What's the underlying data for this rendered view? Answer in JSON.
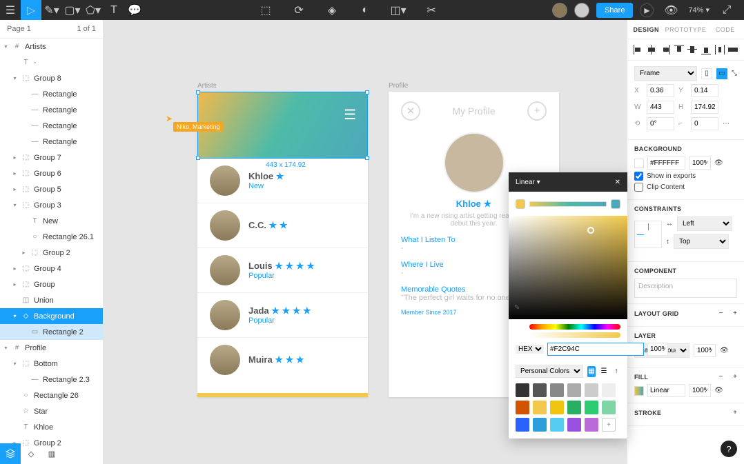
{
  "topbar": {
    "share": "Share",
    "zoom": "74%"
  },
  "pages": {
    "current": "Page 1",
    "count": "1 of 1"
  },
  "layers": [
    {
      "indent": 0,
      "exp": "▾",
      "icon": "#",
      "label": "Artists"
    },
    {
      "indent": 1,
      "exp": "",
      "icon": "T",
      "label": "·"
    },
    {
      "indent": 1,
      "exp": "▾",
      "icon": "⬚",
      "label": "Group 8"
    },
    {
      "indent": 2,
      "exp": "",
      "icon": "—",
      "label": "Rectangle"
    },
    {
      "indent": 2,
      "exp": "",
      "icon": "—",
      "label": "Rectangle"
    },
    {
      "indent": 2,
      "exp": "",
      "icon": "—",
      "label": "Rectangle"
    },
    {
      "indent": 2,
      "exp": "",
      "icon": "—",
      "label": "Rectangle"
    },
    {
      "indent": 1,
      "exp": "▸",
      "icon": "⬚",
      "label": "Group 7"
    },
    {
      "indent": 1,
      "exp": "▸",
      "icon": "⬚",
      "label": "Group 6"
    },
    {
      "indent": 1,
      "exp": "▸",
      "icon": "⬚",
      "label": "Group 5"
    },
    {
      "indent": 1,
      "exp": "▾",
      "icon": "⬚",
      "label": "Group 3"
    },
    {
      "indent": 2,
      "exp": "",
      "icon": "T",
      "label": "New"
    },
    {
      "indent": 2,
      "exp": "",
      "icon": "○",
      "label": "Rectangle 26.1"
    },
    {
      "indent": 2,
      "exp": "▸",
      "icon": "⬚",
      "label": "Group 2"
    },
    {
      "indent": 1,
      "exp": "▸",
      "icon": "⬚",
      "label": "Group 4"
    },
    {
      "indent": 1,
      "exp": "▸",
      "icon": "⬚",
      "label": "Group"
    },
    {
      "indent": 1,
      "exp": "",
      "icon": "◫",
      "label": "Union"
    },
    {
      "indent": 1,
      "exp": "▾",
      "icon": "◇",
      "label": "Background",
      "sel": true
    },
    {
      "indent": 2,
      "exp": "",
      "icon": "▭",
      "label": "Rectangle 2",
      "sel2": true
    },
    {
      "indent": 0,
      "exp": "▾",
      "icon": "#",
      "label": "Profile"
    },
    {
      "indent": 1,
      "exp": "▾",
      "icon": "⬚",
      "label": "Bottom"
    },
    {
      "indent": 2,
      "exp": "",
      "icon": "—",
      "label": "Rectangle 2.3"
    },
    {
      "indent": 1,
      "exp": "",
      "icon": "○",
      "label": "Rectangle 26"
    },
    {
      "indent": 1,
      "exp": "",
      "icon": "☆",
      "label": "Star"
    },
    {
      "indent": 1,
      "exp": "",
      "icon": "T",
      "label": "Khloe"
    },
    {
      "indent": 1,
      "exp": "▸",
      "icon": "⬚",
      "label": "Group 2"
    }
  ],
  "canvas": {
    "frame1_label": "Artists",
    "frame2_label": "Profile",
    "dimensions": "443 x 174.92",
    "cursor_tag": "Niko, Marketing",
    "artists": [
      {
        "name": "Khloe",
        "stars": "★",
        "sub": "New"
      },
      {
        "name": "C.C.",
        "stars": "★ ★",
        "sub": ""
      },
      {
        "name": "Louis",
        "stars": "★ ★ ★ ★",
        "sub": "Popular"
      },
      {
        "name": "Jada",
        "stars": "★ ★ ★ ★",
        "sub": "Popular"
      },
      {
        "name": "Muira",
        "stars": "★ ★ ★",
        "sub": ""
      }
    ],
    "profile": {
      "title": "My Profile",
      "name": "Khloe ★",
      "desc": "I'm a new rising artist getting ready for my debut this year.",
      "listen_label": "What I Listen To",
      "listen_val": "-",
      "live_label": "Where I Live",
      "live_val": "-",
      "quotes_label": "Memorable Quotes",
      "quotes_val": "\"The perfect girl waits for no one.\"",
      "member": "Member Since 2017"
    }
  },
  "picker": {
    "type": "Linear",
    "format": "HEX",
    "hex": "#F2C94C",
    "opacity": "100%",
    "palette_label": "Personal Colors",
    "swatches": [
      "#333",
      "#555",
      "#888",
      "#aaa",
      "#ccc",
      "#eee",
      "#d35400",
      "#f2c94c",
      "#f1c40f",
      "#27ae60",
      "#2ecc71",
      "#7ed6a6",
      "#2962ff",
      "#2d9cdb",
      "#56ccf2",
      "#9b51e0",
      "#bb6bd9"
    ]
  },
  "design": {
    "tabs": [
      "DESIGN",
      "PROTOTYPE",
      "CODE"
    ],
    "frame_type": "Frame",
    "x": "0.36",
    "y": "0.14",
    "w": "443",
    "h": "174.92",
    "rotation": "0°",
    "radius": "0",
    "bg_label": "BACKGROUND",
    "bg_color": "#FFFFFF",
    "bg_opacity": "100%",
    "show_exports": "Show in exports",
    "clip_content": "Clip Content",
    "constraints_label": "CONSTRAINTS",
    "constraint_h": "Left",
    "constraint_v": "Top",
    "component_label": "COMPONENT",
    "component_desc": "Description",
    "grid_label": "LAYOUT GRID",
    "layer_label": "LAYER",
    "blend": "Pass Through",
    "layer_opacity": "100%",
    "fill_label": "FILL",
    "fill_type": "Linear",
    "fill_opacity": "100%",
    "stroke_label": "STROKE"
  }
}
